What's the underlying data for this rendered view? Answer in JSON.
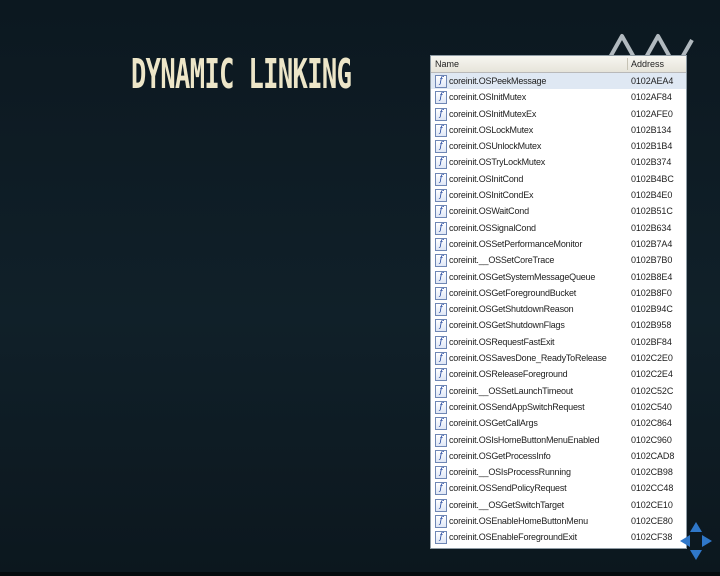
{
  "slide": {
    "title": "DYNAMIC LINKING"
  },
  "table": {
    "columns": {
      "name": "Name",
      "address": "Address"
    },
    "rows": [
      {
        "name": "coreinit.OSPeekMessage",
        "address": "0102AEA4"
      },
      {
        "name": "coreinit.OSInitMutex",
        "address": "0102AF84"
      },
      {
        "name": "coreinit.OSInitMutexEx",
        "address": "0102AFE0"
      },
      {
        "name": "coreinit.OSLockMutex",
        "address": "0102B134"
      },
      {
        "name": "coreinit.OSUnlockMutex",
        "address": "0102B1B4"
      },
      {
        "name": "coreinit.OSTryLockMutex",
        "address": "0102B374"
      },
      {
        "name": "coreinit.OSInitCond",
        "address": "0102B4BC"
      },
      {
        "name": "coreinit.OSInitCondEx",
        "address": "0102B4E0"
      },
      {
        "name": "coreinit.OSWaitCond",
        "address": "0102B51C"
      },
      {
        "name": "coreinit.OSSignalCond",
        "address": "0102B634"
      },
      {
        "name": "coreinit.OSSetPerformanceMonitor",
        "address": "0102B7A4"
      },
      {
        "name": "coreinit.__OSSetCoreTrace",
        "address": "0102B7B0"
      },
      {
        "name": "coreinit.OSGetSystemMessageQueue",
        "address": "0102B8E4"
      },
      {
        "name": "coreinit.OSGetForegroundBucket",
        "address": "0102B8F0"
      },
      {
        "name": "coreinit.OSGetShutdownReason",
        "address": "0102B94C"
      },
      {
        "name": "coreinit.OSGetShutdownFlags",
        "address": "0102B958"
      },
      {
        "name": "coreinit.OSRequestFastExit",
        "address": "0102BF84"
      },
      {
        "name": "coreinit.OSSavesDone_ReadyToRelease",
        "address": "0102C2E0"
      },
      {
        "name": "coreinit.OSReleaseForeground",
        "address": "0102C2E4"
      },
      {
        "name": "coreinit.__OSSetLaunchTimeout",
        "address": "0102C52C"
      },
      {
        "name": "coreinit.OSSendAppSwitchRequest",
        "address": "0102C540"
      },
      {
        "name": "coreinit.OSGetCallArgs",
        "address": "0102C864"
      },
      {
        "name": "coreinit.OSIsHomeButtonMenuEnabled",
        "address": "0102C960"
      },
      {
        "name": "coreinit.OSGetProcessInfo",
        "address": "0102CAD8"
      },
      {
        "name": "coreinit.__OSIsProcessRunning",
        "address": "0102CB98"
      },
      {
        "name": "coreinit.OSSendPolicyRequest",
        "address": "0102CC48"
      },
      {
        "name": "coreinit.__OSGetSwitchTarget",
        "address": "0102CE10"
      },
      {
        "name": "coreinit.OSEnableHomeButtonMenu",
        "address": "0102CE80"
      },
      {
        "name": "coreinit.OSEnableForegroundExit",
        "address": "0102CF38"
      }
    ],
    "icon_glyph": "f",
    "selected_row": 0
  },
  "colors": {
    "background": "#0e1a22",
    "title": "#ede6c8",
    "selection": "#dfe8f3",
    "icon_border": "#6f87b5"
  },
  "icons": {
    "function": "function-icon",
    "logo": "logo-icon",
    "nav": "slide-nav-arrows-icon"
  }
}
